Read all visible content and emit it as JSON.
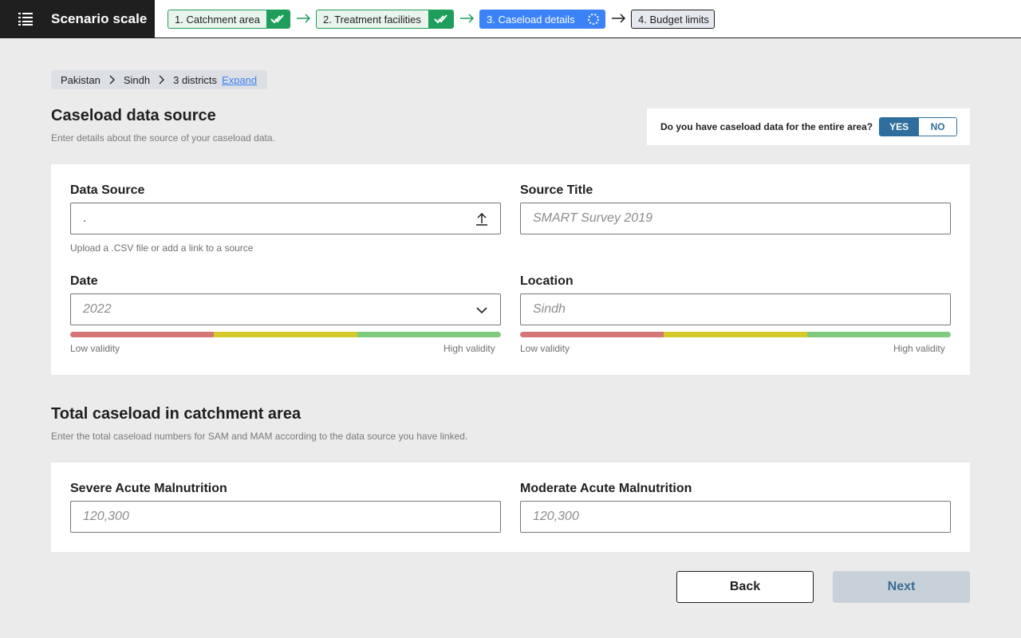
{
  "app": {
    "title": "Scenario scale"
  },
  "steps": [
    {
      "label": "1. Catchment area",
      "status": "done"
    },
    {
      "label": "2. Treatment facilities",
      "status": "done"
    },
    {
      "label": "3. Caseload details",
      "status": "active"
    },
    {
      "label": "4. Budget limits",
      "status": "todo"
    }
  ],
  "breadcrumb": {
    "country": "Pakistan",
    "province": "Sindh",
    "districts": "3 districts",
    "expand_label": "Expand"
  },
  "source_section": {
    "title": "Caseload data source",
    "subtitle": "Enter details about the source of your caseload data.",
    "question": "Do you have caseload data for the entire area?",
    "yes_label": "YES",
    "no_label": "NO",
    "selected": "YES"
  },
  "form": {
    "data_source": {
      "label": "Data Source",
      "value": ".",
      "hint": "Upload a .CSV file or add a link to a source"
    },
    "source_title": {
      "label": "Source Title",
      "placeholder": "SMART Survey 2019"
    },
    "date": {
      "label": "Date",
      "value": "2022"
    },
    "location": {
      "label": "Location",
      "placeholder": "Sindh"
    },
    "validity": {
      "low": "Low validity",
      "high": "High validity"
    }
  },
  "caseload_section": {
    "title": "Total caseload in catchment area",
    "subtitle": "Enter the total caseload numbers for SAM and MAM according to the data source you have linked.",
    "sam": {
      "label": "Severe Acute Malnutrition",
      "placeholder": "120,300"
    },
    "mam": {
      "label": "Moderate Acute Malnutrition",
      "placeholder": "120,300"
    }
  },
  "actions": {
    "back_label": "Back",
    "next_label": "Next"
  },
  "colors": {
    "done": "#1e9e5a",
    "active": "#3b82f6",
    "yes_fill": "#2f6e9c",
    "low": "#d47676",
    "mid": "#d4cb2a",
    "high": "#7ecb7e"
  }
}
